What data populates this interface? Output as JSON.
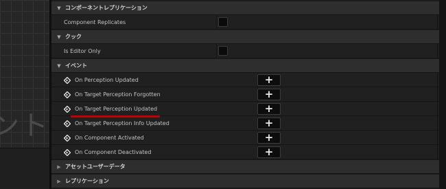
{
  "viewport": {
    "watermark": "ント"
  },
  "sections": {
    "replication_component": {
      "title": "コンポーネントレプリケーション",
      "property": "Component Replicates"
    },
    "cook": {
      "title": "クック",
      "property": "Is Editor Only"
    },
    "events": {
      "title": "イベント",
      "items": [
        "On Perception Updated",
        "On Target Perception Forgotten",
        "On Target Perception Updated",
        "On Target Perception Info Updated",
        "On Component Activated",
        "On Component Deactivated"
      ],
      "add_label": "+"
    },
    "asset_user_data": {
      "title": "アセットユーザーデータ"
    },
    "replication": {
      "title": "レプリケーション"
    }
  },
  "colors": {
    "highlight_underline": "#c40000",
    "panel_bg": "#1c1c1c",
    "header_bg": "#2e2e2e"
  },
  "icons": {
    "expanded": "triangle-down-icon",
    "collapsed": "triangle-right-icon",
    "event": "event-diamond-icon"
  }
}
